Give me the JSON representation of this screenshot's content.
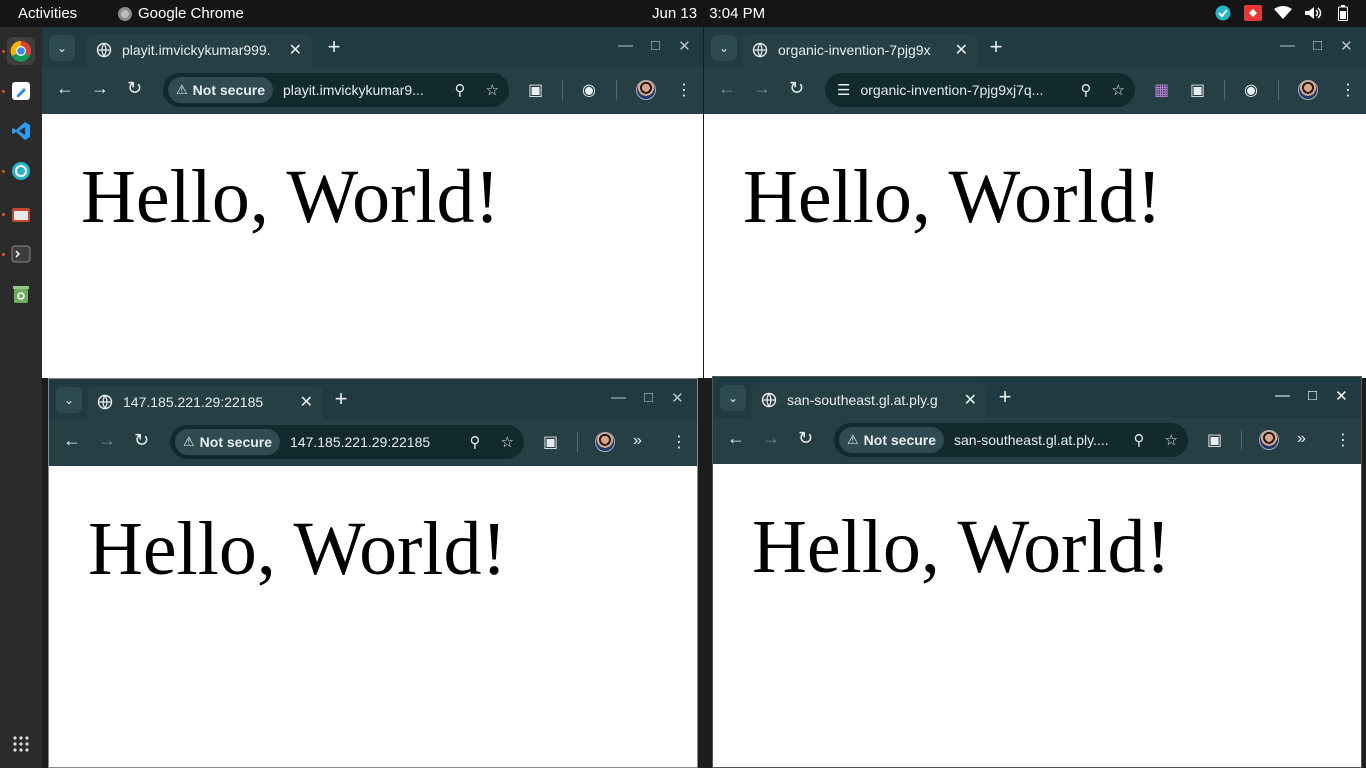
{
  "topbar": {
    "activities": "Activities",
    "app_name": "Google Chrome",
    "date": "Jun 13",
    "time": "3:04 PM"
  },
  "windows": {
    "top_left": {
      "tab_title": "playit.imvickykumar999.",
      "security_label": "Not secure",
      "url": "playit.imvickykumar9...",
      "page_text": "Hello, World!"
    },
    "top_right": {
      "tab_title": "organic-invention-7pjg9x",
      "url": "organic-invention-7pjg9xj7q...",
      "page_text": "Hello, World!"
    },
    "bottom_left": {
      "tab_title": "147.185.221.29:22185",
      "security_label": "Not secure",
      "url": "147.185.221.29:22185",
      "page_text": "Hello, World!"
    },
    "bottom_right": {
      "tab_title": "san-southeast.gl.at.ply.g",
      "security_label": "Not secure",
      "url": "san-southeast.gl.at.ply....",
      "page_text": "Hello, World!"
    }
  },
  "colors": {
    "tabbar": "#1f3a40",
    "toolbar": "#263f45",
    "omnibox": "#12292e",
    "topbar": "#151515",
    "dock": "#2b2b2b",
    "accent_dot": "#e95420"
  }
}
